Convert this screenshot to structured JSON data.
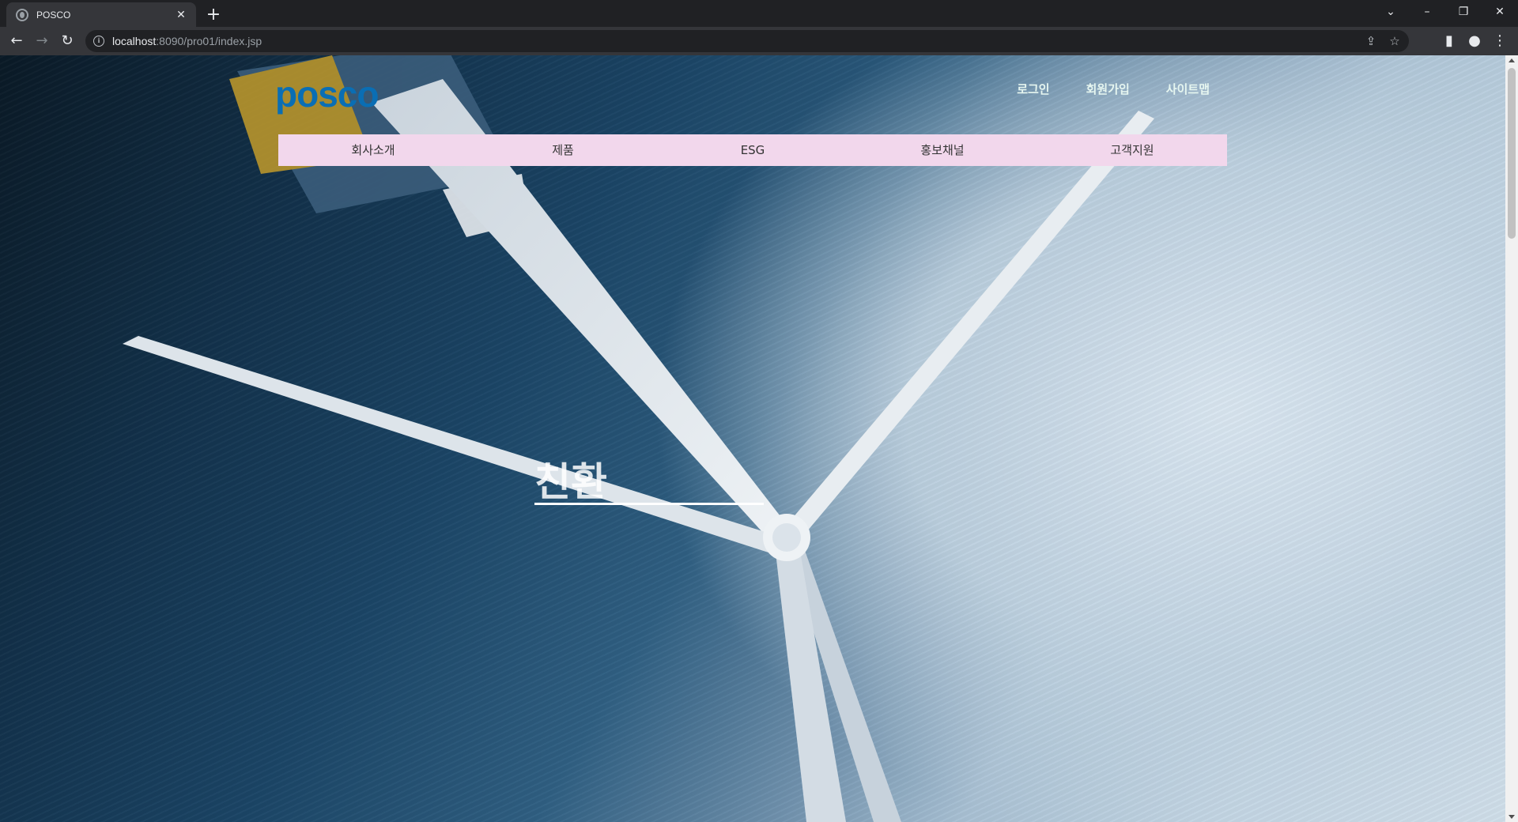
{
  "browser": {
    "tab": {
      "title": "POSCO",
      "icon": "globe-icon"
    },
    "new_tab_label": "+",
    "address": {
      "host": "localhost",
      "path": ":8090/pro01/index.jsp"
    },
    "window_controls": {
      "minimize": "–",
      "restore": "❐",
      "close": "✕",
      "tabsearch": "⌄"
    }
  },
  "page": {
    "logo": "posco",
    "util_links": [
      "로그인",
      "회원가입",
      "사이트맵"
    ],
    "nav": [
      "회사소개",
      "제품",
      "ESG",
      "홍보채널",
      "고객지원"
    ],
    "hero_text": "친환",
    "colors": {
      "nav_bg": "#f2d7ec",
      "logo": "#0a6eb4",
      "util_link": "#e6f6f0"
    }
  }
}
